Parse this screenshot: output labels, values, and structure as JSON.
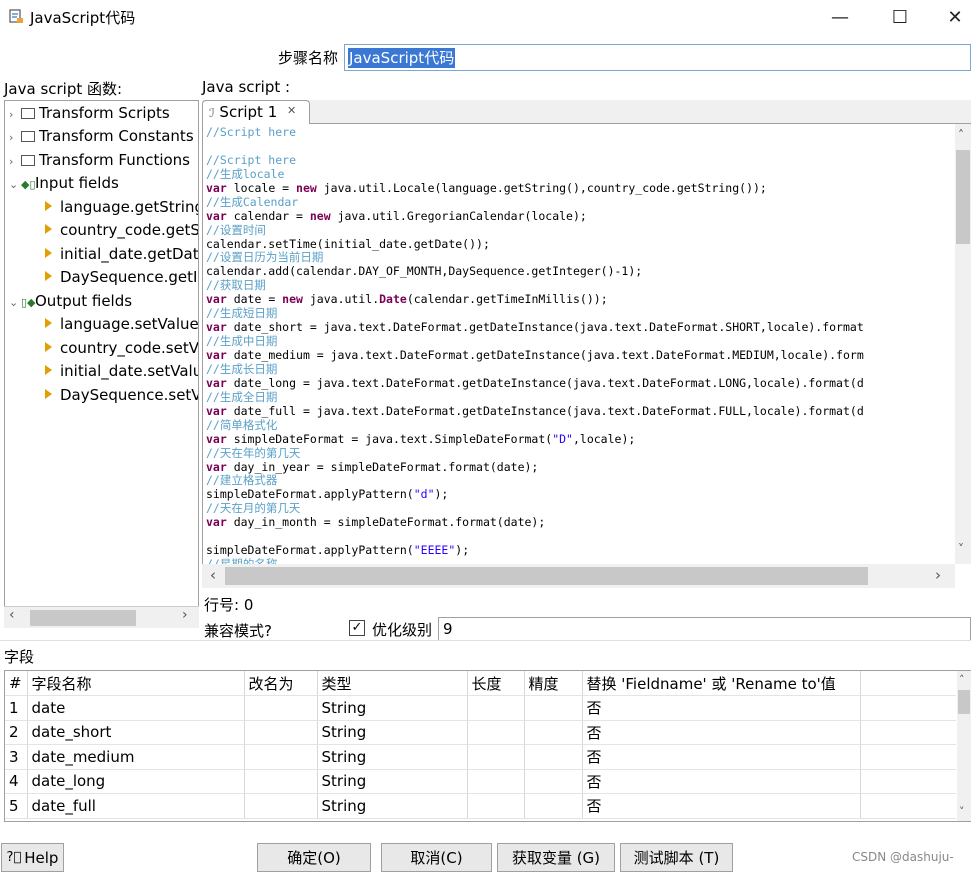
{
  "window": {
    "title": "JavaScript代码",
    "minimize_glyph": "—",
    "maximize_glyph": "☐",
    "close_glyph": "✕"
  },
  "step": {
    "label": "步骤名称",
    "value": "JavaScript代码"
  },
  "left_panel": {
    "label": "Java script 函数:",
    "tree": [
      {
        "label": "Transform Scripts",
        "type": "folder"
      },
      {
        "label": "Transform Constants",
        "type": "folder"
      },
      {
        "label": "Transform Functions",
        "type": "folder"
      },
      {
        "label": "Input fields",
        "type": "group"
      },
      {
        "label": "language.getString",
        "type": "field"
      },
      {
        "label": "country_code.getS",
        "type": "field"
      },
      {
        "label": "initial_date.getDat",
        "type": "field"
      },
      {
        "label": "DaySequence.getIn",
        "type": "field"
      },
      {
        "label": "Output fields",
        "type": "group"
      },
      {
        "label": "language.setValue",
        "type": "field"
      },
      {
        "label": "country_code.setV",
        "type": "field"
      },
      {
        "label": "initial_date.setValu",
        "type": "field"
      },
      {
        "label": "DaySequence.setV",
        "type": "field"
      }
    ]
  },
  "script_panel": {
    "label": "Java script :",
    "tab_label": "Script 1",
    "code_lines": [
      "//Script here",
      "",
      "//Script here",
      "//生成locale",
      "var locale = new java.util.Locale(language.getString(),country_code.getString());",
      "//生成Calendar",
      "var calendar = new java.util.GregorianCalendar(locale);",
      "//设置时间",
      "calendar.setTime(initial_date.getDate());",
      "//设置日历为当前日期",
      "calendar.add(calendar.DAY_OF_MONTH,DaySequence.getInteger()-1);",
      "//获取日期",
      "var date = new java.util.Date(calendar.getTimeInMillis());",
      "//生成短日期",
      "var date_short = java.text.DateFormat.getDateInstance(java.text.DateFormat.SHORT,locale).format",
      "//生成中日期",
      "var date_medium = java.text.DateFormat.getDateInstance(java.text.DateFormat.MEDIUM,locale).form",
      "//生成长日期",
      "var date_long = java.text.DateFormat.getDateInstance(java.text.DateFormat.LONG,locale).format(d",
      "//生成全日期",
      "var date_full = java.text.DateFormat.getDateInstance(java.text.DateFormat.FULL,locale).format(d",
      "//简单格式化",
      "var simpleDateFormat = java.text.SimpleDateFormat(\"D\",locale);",
      "//天在年的第几天",
      "var day_in_year = simpleDateFormat.format(date);",
      "//建立格式器",
      "simpleDateFormat.applyPattern(\"d\");",
      "//天在月的第几天",
      "var day_in_month = simpleDateFormat.format(date);",
      "",
      "simpleDateFormat.applyPattern(\"EEEE\");",
      "//星期的名称"
    ],
    "line_number_label": "行号: 0",
    "compat_label": "兼容模式?",
    "optimize_label": "优化级别",
    "optimize_value": "9"
  },
  "fields": {
    "label": "字段",
    "columns": [
      "#",
      "字段名称",
      "改名为",
      "类型",
      "长度",
      "精度",
      "替换 'Fieldname' 或 'Rename to'值"
    ],
    "rows": [
      [
        "1",
        "date",
        "",
        "String",
        "",
        "",
        "否"
      ],
      [
        "2",
        "date_short",
        "",
        "String",
        "",
        "",
        "否"
      ],
      [
        "3",
        "date_medium",
        "",
        "String",
        "",
        "",
        "否"
      ],
      [
        "4",
        "date_long",
        "",
        "String",
        "",
        "",
        "否"
      ],
      [
        "5",
        "date_full",
        "",
        "String",
        "",
        "",
        "否"
      ]
    ]
  },
  "buttons": {
    "help": "Help",
    "ok": "确定(O)",
    "cancel": "取消(C)",
    "get_vars": "获取变量 (G)",
    "test": "测试脚本 (T)"
  },
  "watermark": "CSDN @dashuju-"
}
